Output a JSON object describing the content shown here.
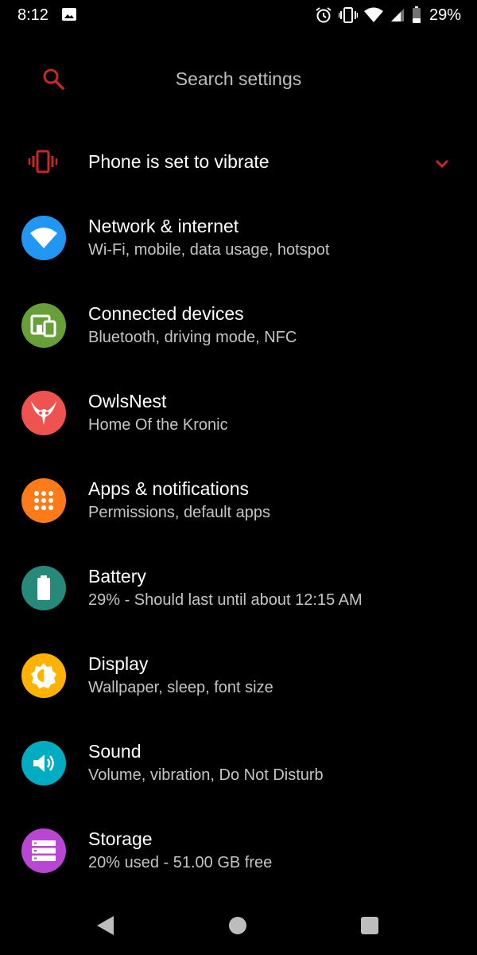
{
  "status_bar": {
    "time": "8:12",
    "battery_percent": "29%"
  },
  "search": {
    "placeholder": "Search settings"
  },
  "vibrate_banner": {
    "label": "Phone is set to vibrate"
  },
  "accent_color": "#c62828",
  "settings": [
    {
      "title": "Network & internet",
      "subtitle": "Wi-Fi, mobile, data usage, hotspot",
      "icon": "wifi-icon",
      "color": "#2196f3"
    },
    {
      "title": "Connected devices",
      "subtitle": "Bluetooth, driving mode, NFC",
      "icon": "devices-icon",
      "color": "#689f38"
    },
    {
      "title": "OwlsNest",
      "subtitle": "Home Of the Kronic",
      "icon": "owl-icon",
      "color": "#ef5350"
    },
    {
      "title": "Apps & notifications",
      "subtitle": "Permissions, default apps",
      "icon": "apps-grid-icon",
      "color": "#ff7b1a"
    },
    {
      "title": "Battery",
      "subtitle": "29% - Should last until about 12:15 AM",
      "icon": "battery-icon",
      "color": "#26897a"
    },
    {
      "title": "Display",
      "subtitle": "Wallpaper, sleep, font size",
      "icon": "brightness-icon",
      "color": "#ffb300"
    },
    {
      "title": "Sound",
      "subtitle": "Volume, vibration, Do Not Disturb",
      "icon": "volume-icon",
      "color": "#00acc1"
    },
    {
      "title": "Storage",
      "subtitle": "20% used - 51.00 GB free",
      "icon": "storage-icon",
      "color": "#ba47d4"
    }
  ]
}
